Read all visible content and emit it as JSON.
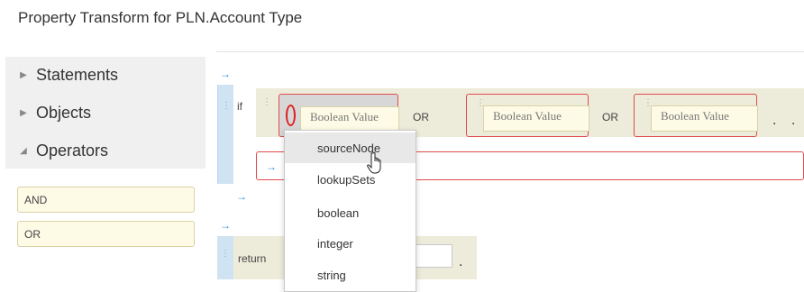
{
  "title": "Property Transform for PLN.Account Type",
  "sidebar": {
    "items": [
      {
        "label": "Statements",
        "icon": "triangle-right-icon",
        "glyph": "▶"
      },
      {
        "label": "Objects",
        "icon": "triangle-right-icon",
        "glyph": "▶"
      },
      {
        "label": "Operators",
        "icon": "triangle-down-icon",
        "glyph": "◢"
      }
    ]
  },
  "operators": [
    "AND",
    "OR"
  ],
  "glyphs": {
    "arrow": "→",
    "handle": "⋮",
    "dot": "."
  },
  "editor": {
    "if_label": "if",
    "condition": {
      "or_label": "OR",
      "operands": [
        "Boolean Value",
        "Boolean Value",
        "Boolean Value"
      ]
    },
    "return_label": "return"
  },
  "dropdown": {
    "items": [
      "sourceNode",
      "lookupSets",
      "boolean",
      "integer",
      "string"
    ],
    "hovered": "sourceNode"
  },
  "colors": {
    "highlight_border": "#e14c4c",
    "statement_bar": "#cfe3f3",
    "block_background": "#edebd9",
    "chip_background": "#fdfbe6",
    "arrow": "#2b8bd6"
  }
}
